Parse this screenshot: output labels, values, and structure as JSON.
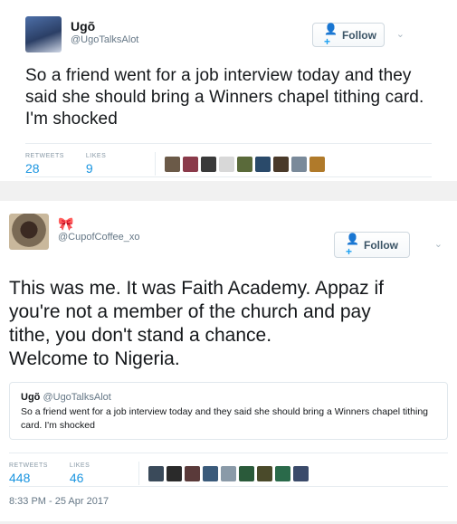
{
  "tweet1": {
    "display_name": "Ugõ",
    "handle": "@UgoTalksAlot",
    "follow_label": "Follow",
    "text": "So a friend went for a job interview today and they said she should bring a Winners chapel tithing card. I'm shocked",
    "retweets_label": "RETWEETS",
    "retweets": "28",
    "likes_label": "LIKES",
    "likes": "9",
    "liker_colors": [
      "#6b5a48",
      "#8a3a4a",
      "#3a3a3a",
      "#d8d8d8",
      "#5a6a3a",
      "#2a4a6a",
      "#4a3a2a",
      "#7a8a9a",
      "#b07a2a"
    ]
  },
  "tweet2": {
    "handle": "@CupofCoffee_xo",
    "follow_label": "Follow",
    "text_lines": [
      "This was me. It was Faith Academy. Appaz if",
      "you're not a member of the church and pay",
      "tithe, you don't stand a chance.",
      "Welcome to Nigeria."
    ],
    "quote": {
      "name": "Ugõ",
      "handle": "@UgoTalksAlot",
      "text": "So a friend went for a job interview today and they said she should bring a Winners chapel tithing card. I'm shocked"
    },
    "retweets_label": "RETWEETS",
    "retweets": "448",
    "likes_label": "LIKES",
    "likes": "46",
    "liker_colors": [
      "#3a4a5a",
      "#2a2a2a",
      "#5a3a3a",
      "#3a5a7a",
      "#8a9aa8",
      "#2a5a3a",
      "#4a4a2a",
      "#2a6a4a",
      "#3a4a6a"
    ],
    "timestamp": "8:33 PM - 25 Apr 2017"
  },
  "icons": {
    "follow": "person-plus-icon",
    "more": "chevron-down-icon",
    "ribbon": "ribbon-icon"
  }
}
